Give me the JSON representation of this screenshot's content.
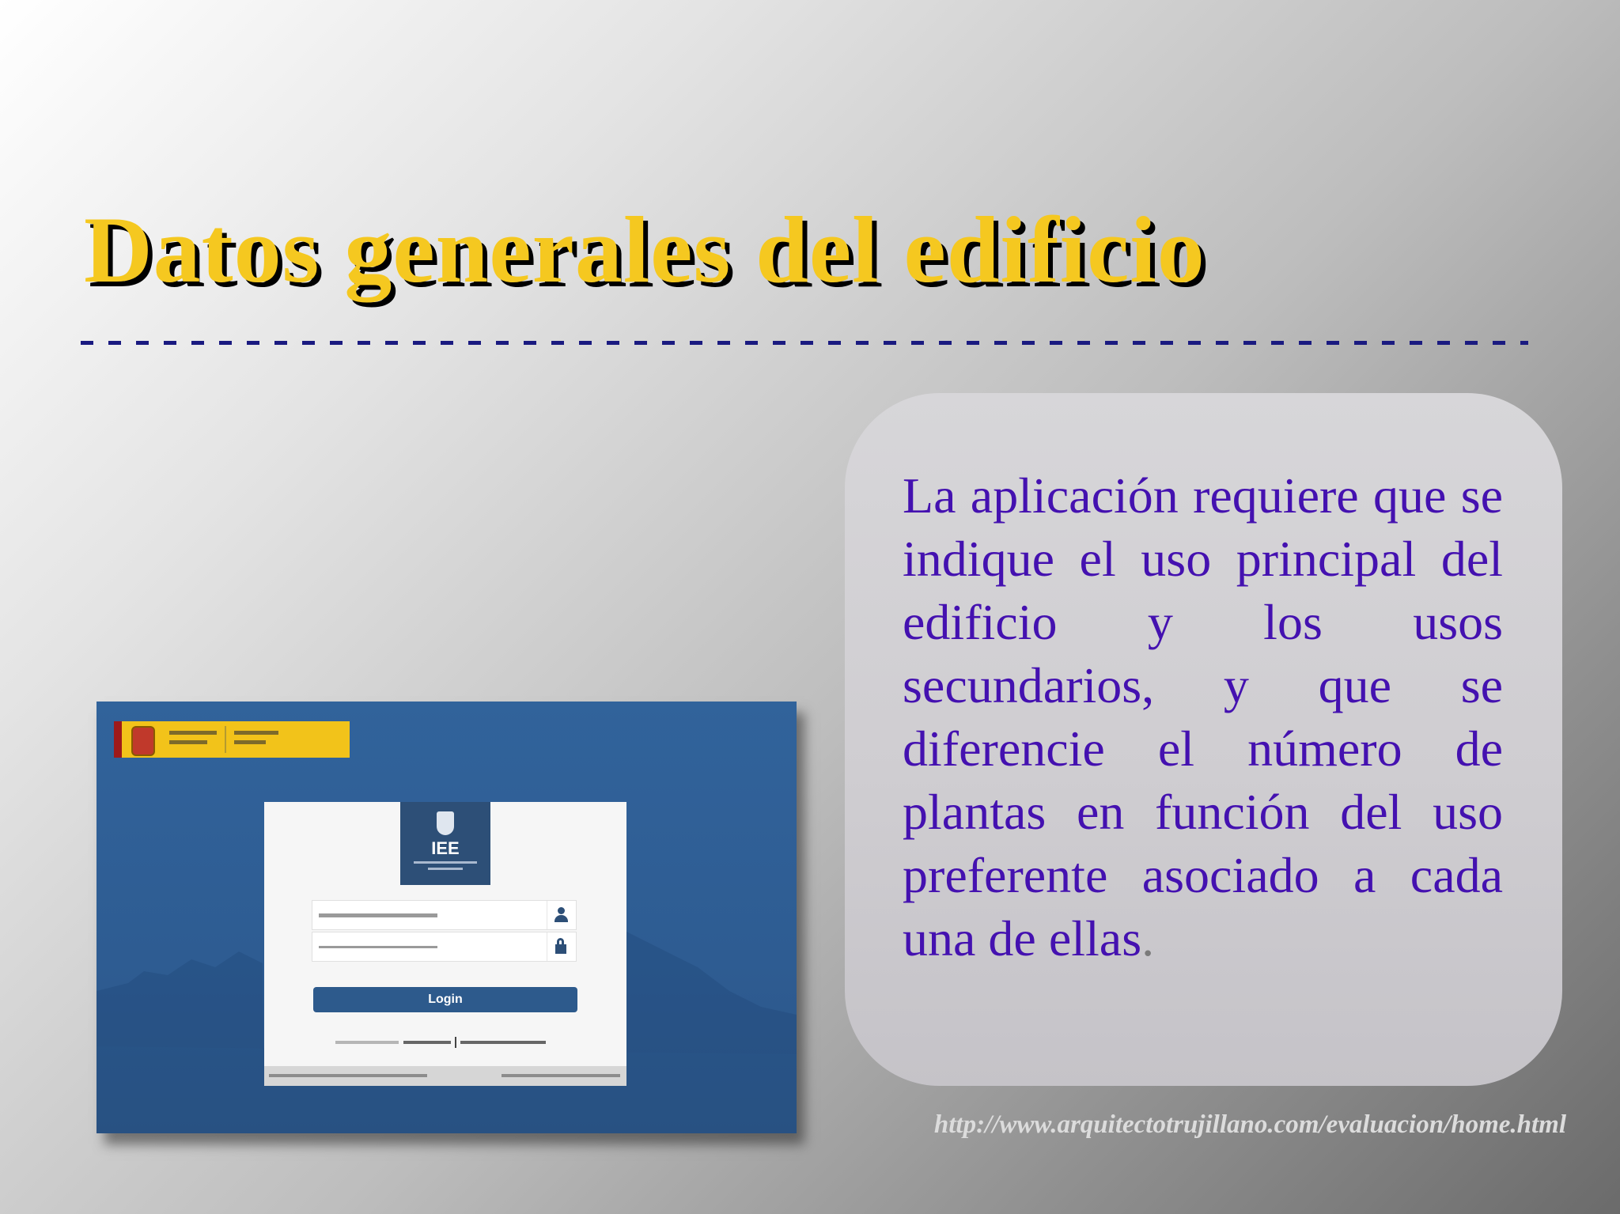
{
  "slide": {
    "title": "Datos generales del edificio",
    "body_text": "La aplicación requiere que se indique el uso principal del edificio y los usos secundarios, y que se diferencie el número de plantas en función del uso preferente asociado a cada una de ellas",
    "body_period": ".",
    "source_url": "http://www.arquitectotrujillano.com/evaluacion/home.html"
  },
  "screenshot": {
    "logo_text": "IEE",
    "login_button": "Login",
    "icons": [
      "user-icon",
      "lock-icon"
    ]
  },
  "colors": {
    "title": "#f5c820",
    "title_shadow": "#000000",
    "body_text": "#4411b0",
    "rule": "#1a1a80",
    "screenshot_bg": "#31639b",
    "logo_bg": "#2d4f77"
  }
}
